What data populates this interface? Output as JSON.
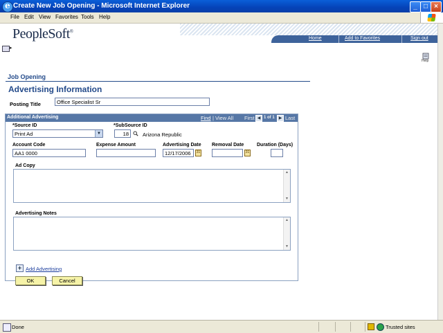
{
  "window": {
    "title": "Create New Job Opening - Microsoft Internet Explorer"
  },
  "menu": {
    "items": [
      "File",
      "Edit",
      "View",
      "Favorites",
      "Tools",
      "Help"
    ]
  },
  "brand": {
    "name": "PeopleSoft",
    "mark": "®"
  },
  "nav": {
    "home": "Home",
    "favorites": "Add to Favorites",
    "signout": "Sign out"
  },
  "help": {
    "label": "Help"
  },
  "page": {
    "section": "Job Opening",
    "title": "Advertising Information",
    "posting_title_label": "Posting Title",
    "posting_title_value": "Office Specialist Sr"
  },
  "grid": {
    "title": "Additional Advertising",
    "find": "Find",
    "sep": "|",
    "view_all": "View All",
    "first": "First",
    "count": "1 of 1",
    "last": "Last"
  },
  "form": {
    "source_id_label": "*Source ID",
    "source_id_value": "Print Ad",
    "subsource_id_label": "*SubSource ID",
    "subsource_id_value": "18",
    "subsource_desc": "Arizona Republic",
    "account_code_label": "Account Code",
    "account_code_value": "AA1 0000",
    "expense_amount_label": "Expense Amount",
    "expense_amount_value": "",
    "advertising_date_label": "Advertising Date",
    "advertising_date_value": "12/17/2006",
    "removal_date_label": "Removal Date",
    "removal_date_value": "",
    "duration_label": "Duration (Days)",
    "duration_value": "",
    "ad_copy_label": "Ad Copy",
    "advertising_notes_label": "Advertising Notes"
  },
  "actions": {
    "add_advertising": "Add Advertising",
    "ok": "OK",
    "cancel": "Cancel"
  },
  "status": {
    "text": "Done",
    "zone": "Trusted sites"
  },
  "colors": {
    "titlebar": "#0543b8",
    "header": "#5677a6",
    "accent": "#234a8a",
    "button": "#f6f3a8"
  }
}
